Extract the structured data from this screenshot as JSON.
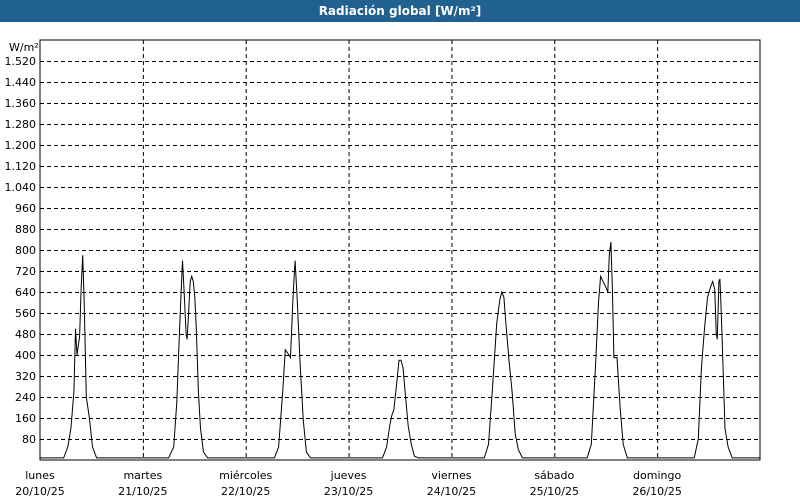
{
  "window": {
    "title": "Radiación global [W/m²]"
  },
  "chart_data": {
    "type": "line",
    "title": "Radiación global [W/m²]",
    "ylabel": "W/m²",
    "xlabel": "",
    "ylim": [
      0,
      1600
    ],
    "yticks": [
      "80",
      "160",
      "240",
      "320",
      "400",
      "480",
      "560",
      "640",
      "720",
      "800",
      "880",
      "960",
      "1.040",
      "1.120",
      "1.200",
      "1.280",
      "1.360",
      "1.440",
      "1.520"
    ],
    "ytick_values": [
      80,
      160,
      240,
      320,
      400,
      480,
      560,
      640,
      720,
      800,
      880,
      960,
      1040,
      1120,
      1200,
      1280,
      1360,
      1440,
      1520
    ],
    "grid": true,
    "days": [
      {
        "name": "lunes",
        "date": "20/10/25"
      },
      {
        "name": "martes",
        "date": "21/10/25"
      },
      {
        "name": "miércoles",
        "date": "22/10/25"
      },
      {
        "name": "jueves",
        "date": "23/10/25"
      },
      {
        "name": "viernes",
        "date": "24/10/25"
      },
      {
        "name": "sábado",
        "date": "25/10/25"
      },
      {
        "name": "domingo",
        "date": "26/10/25"
      }
    ],
    "series": [
      {
        "name": "",
        "color": "#000000",
        "points": [
          [
            0.0,
            8
          ],
          [
            0.23,
            8
          ],
          [
            0.27,
            50
          ],
          [
            0.3,
            120
          ],
          [
            0.33,
            260
          ],
          [
            0.345,
            500
          ],
          [
            0.36,
            400
          ],
          [
            0.385,
            470
          ],
          [
            0.4,
            650
          ],
          [
            0.415,
            780
          ],
          [
            0.43,
            600
          ],
          [
            0.45,
            240
          ],
          [
            0.48,
            160
          ],
          [
            0.51,
            50
          ],
          [
            0.55,
            8
          ],
          [
            1.0,
            8
          ],
          [
            1.25,
            8
          ],
          [
            1.3,
            50
          ],
          [
            1.33,
            220
          ],
          [
            1.355,
            480
          ],
          [
            1.37,
            620
          ],
          [
            1.385,
            760
          ],
          [
            1.4,
            650
          ],
          [
            1.42,
            480
          ],
          [
            1.43,
            460
          ],
          [
            1.445,
            560
          ],
          [
            1.46,
            680
          ],
          [
            1.475,
            700
          ],
          [
            1.49,
            680
          ],
          [
            1.505,
            620
          ],
          [
            1.52,
            500
          ],
          [
            1.54,
            260
          ],
          [
            1.56,
            120
          ],
          [
            1.59,
            30
          ],
          [
            1.63,
            8
          ],
          [
            2.0,
            8
          ],
          [
            2.28,
            8
          ],
          [
            2.32,
            50
          ],
          [
            2.36,
            260
          ],
          [
            2.385,
            420
          ],
          [
            2.42,
            400
          ],
          [
            2.435,
            390
          ],
          [
            2.46,
            620
          ],
          [
            2.48,
            760
          ],
          [
            2.5,
            620
          ],
          [
            2.53,
            360
          ],
          [
            2.56,
            150
          ],
          [
            2.59,
            30
          ],
          [
            2.63,
            8
          ],
          [
            3.0,
            8
          ],
          [
            3.33,
            8
          ],
          [
            3.37,
            50
          ],
          [
            3.4,
            130
          ],
          [
            3.42,
            170
          ],
          [
            3.44,
            190
          ],
          [
            3.47,
            300
          ],
          [
            3.49,
            380
          ],
          [
            3.51,
            380
          ],
          [
            3.53,
            350
          ],
          [
            3.55,
            260
          ],
          [
            3.58,
            130
          ],
          [
            3.61,
            60
          ],
          [
            3.64,
            15
          ],
          [
            3.68,
            8
          ],
          [
            4.0,
            8
          ],
          [
            4.32,
            8
          ],
          [
            4.36,
            60
          ],
          [
            4.4,
            280
          ],
          [
            4.44,
            520
          ],
          [
            4.47,
            610
          ],
          [
            4.49,
            640
          ],
          [
            4.51,
            620
          ],
          [
            4.53,
            520
          ],
          [
            4.56,
            380
          ],
          [
            4.59,
            260
          ],
          [
            4.62,
            100
          ],
          [
            4.65,
            40
          ],
          [
            4.69,
            8
          ],
          [
            5.0,
            8
          ],
          [
            5.32,
            8
          ],
          [
            5.36,
            60
          ],
          [
            5.4,
            350
          ],
          [
            5.43,
            600
          ],
          [
            5.45,
            700
          ],
          [
            5.475,
            680
          ],
          [
            5.5,
            660
          ],
          [
            5.52,
            640
          ],
          [
            5.535,
            780
          ],
          [
            5.55,
            830
          ],
          [
            5.565,
            650
          ],
          [
            5.58,
            390
          ],
          [
            5.61,
            390
          ],
          [
            5.64,
            200
          ],
          [
            5.67,
            60
          ],
          [
            5.71,
            8
          ],
          [
            6.0,
            8
          ],
          [
            6.36,
            8
          ],
          [
            6.4,
            80
          ],
          [
            6.43,
            350
          ],
          [
            6.46,
            500
          ],
          [
            6.49,
            620
          ],
          [
            6.52,
            660
          ],
          [
            6.54,
            680
          ],
          [
            6.56,
            650
          ],
          [
            6.575,
            480
          ],
          [
            6.585,
            460
          ],
          [
            6.6,
            680
          ],
          [
            6.61,
            690
          ],
          [
            6.62,
            600
          ],
          [
            6.64,
            360
          ],
          [
            6.66,
            120
          ],
          [
            6.69,
            50
          ],
          [
            6.73,
            8
          ],
          [
            7.0,
            8
          ]
        ]
      }
    ]
  }
}
